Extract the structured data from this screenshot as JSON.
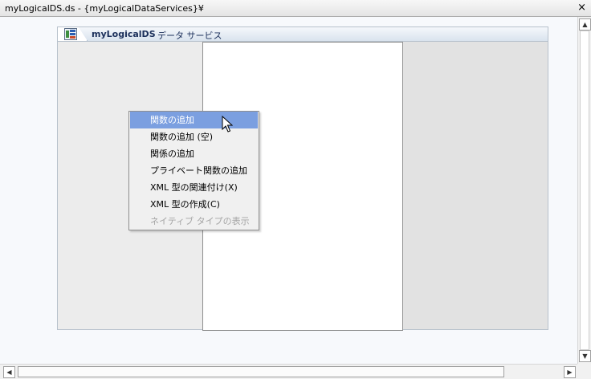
{
  "window": {
    "title": "myLogicalDS.ds - {myLogicalDataServices}¥",
    "close_glyph": "×"
  },
  "designer": {
    "name": "myLogicalDS",
    "type_label": "データ サービス"
  },
  "context_menu": {
    "items": [
      {
        "label": "関数の追加",
        "state": "highlighted"
      },
      {
        "label": "関数の追加 (空)",
        "state": "enabled"
      },
      {
        "label": "関係の追加",
        "state": "enabled"
      },
      {
        "label": "プライベート関数の追加",
        "state": "enabled"
      },
      {
        "label": "XML 型の関連付け(X)",
        "state": "enabled"
      },
      {
        "label": "XML 型の作成(C)",
        "state": "enabled"
      },
      {
        "label": "ネイティブ タイプの表示",
        "state": "disabled"
      }
    ]
  },
  "scrollbars": {
    "up_arrow": "▲",
    "down_arrow": "▼",
    "left_arrow": "◀",
    "right_arrow": "▶"
  },
  "colors": {
    "menu_highlight": "#7b9fe0",
    "header_text": "#1b2f5a"
  }
}
